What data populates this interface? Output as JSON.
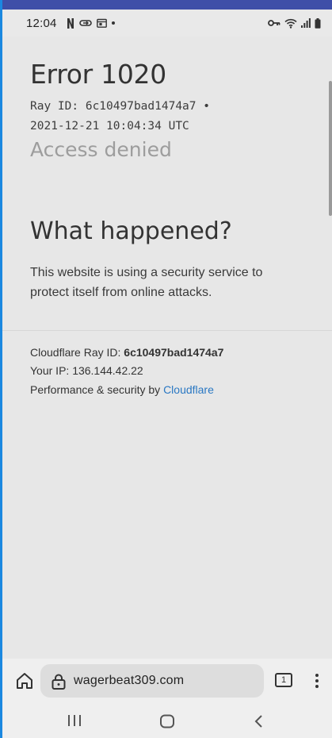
{
  "status_bar": {
    "time": "12:04",
    "left_icons": [
      "netflix-n-icon",
      "cloud-sync-icon",
      "calendar-icon",
      "notification-dot"
    ],
    "right_icons": [
      "vpn-key-icon",
      "wifi-icon",
      "signal-icon",
      "battery-icon"
    ]
  },
  "page": {
    "error_title": "Error 1020",
    "ray_line_1": "Ray ID: 6c10497bad1474a7 •",
    "ray_line_2": "2021-12-21 10:04:34 UTC",
    "access_denied": "Access denied",
    "what_happened_title": "What happened?",
    "what_happened_text": "This website is using a security service to protect itself from online attacks.",
    "footer": {
      "ray_label": "Cloudflare Ray ID:",
      "ray_value": "6c10497bad1474a7",
      "ip_label": "Your IP:",
      "ip_value": "136.144.42.22",
      "perf_label": "Performance & security by",
      "perf_link": "Cloudflare"
    }
  },
  "browser_bar": {
    "url": "wagerbeat309.com",
    "tab_count": "1"
  },
  "colors": {
    "top_accent": "#3f4fa8",
    "link": "#2a78c3",
    "page_background": "#e7e7e7"
  }
}
